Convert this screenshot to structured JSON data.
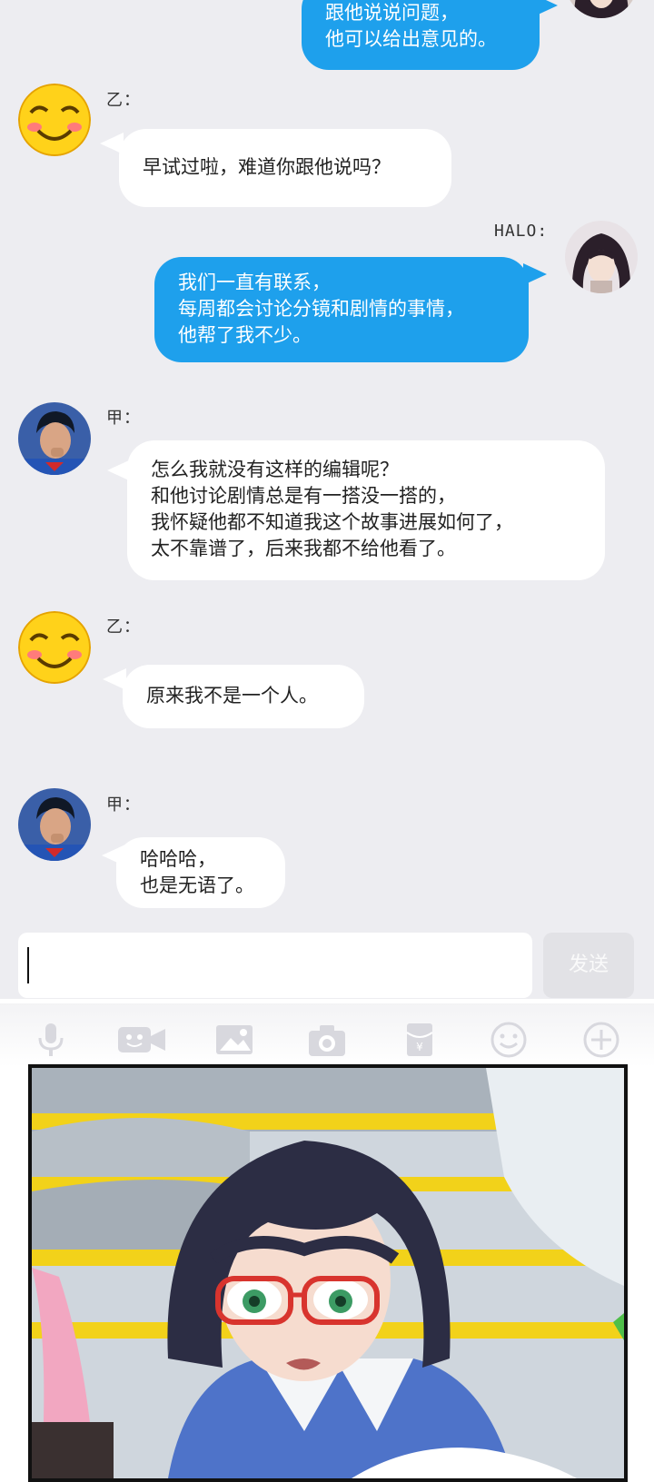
{
  "chat": {
    "messages": [
      {
        "side": "right",
        "lines": [
          "跟他说说问题，",
          "他可以给出意见的。"
        ]
      },
      {
        "side": "left",
        "sender": "乙：",
        "lines": [
          "早试过啦，难道你跟他说吗？"
        ]
      },
      {
        "side": "right",
        "sender": "HALO:",
        "lines": [
          "我们一直有联系，",
          "每周都会讨论分镜和剧情的事情，",
          "他帮了我不少。"
        ]
      },
      {
        "side": "left",
        "sender": "甲：",
        "lines": [
          "怎么我就没有这样的编辑呢？",
          "和他讨论剧情总是有一搭没一搭的，",
          "我怀疑他都不知道我这个故事进展如何了，",
          "太不靠谱了，后来我都不给他看了。"
        ]
      },
      {
        "side": "left",
        "sender": "乙：",
        "lines": [
          "原来我不是一个人。"
        ]
      },
      {
        "side": "left",
        "sender": "甲：",
        "lines": [
          "哈哈哈，",
          "也是无语了。"
        ]
      }
    ]
  },
  "input": {
    "value": "",
    "send_label": "发送"
  },
  "toolbar": {
    "icons": [
      "microphone-icon",
      "video-icon",
      "image-icon",
      "camera-icon",
      "red-envelope-icon",
      "emoji-icon",
      "plus-icon"
    ]
  },
  "colors": {
    "chat_bg": "#ededf1",
    "bubble_blue": "#1ea0ec",
    "bubble_white": "#ffffff"
  }
}
